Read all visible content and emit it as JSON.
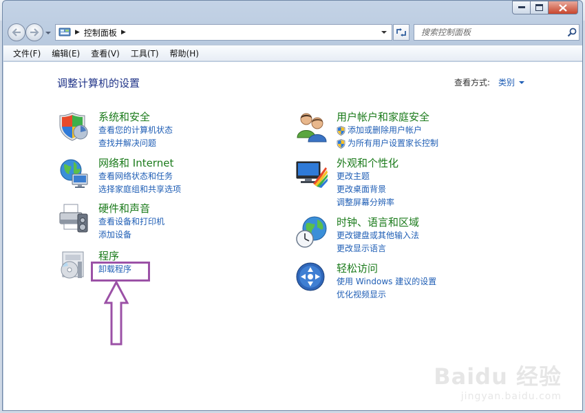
{
  "window": {
    "caption_buttons": [
      "minimize",
      "maximize",
      "close"
    ]
  },
  "nav": {
    "back_icon": "back-arrow-icon",
    "forward_icon": "forward-arrow-icon",
    "address_path": "控制面板",
    "search_placeholder": "搜索控制面板"
  },
  "menu": {
    "items": [
      "文件(F)",
      "编辑(E)",
      "查看(V)",
      "工具(T)",
      "帮助(H)"
    ]
  },
  "content": {
    "title": "调整计算机的设置",
    "view_by_label": "查看方式:",
    "view_by_value": "类别"
  },
  "categories": {
    "system": {
      "title": "系统和安全",
      "links": [
        "查看您的计算机状态",
        "查找并解决问题"
      ]
    },
    "network": {
      "title": "网络和 Internet",
      "links": [
        "查看网络状态和任务",
        "选择家庭组和共享选项"
      ]
    },
    "hardware": {
      "title": "硬件和声音",
      "links": [
        "查看设备和打印机",
        "添加设备"
      ]
    },
    "programs": {
      "title": "程序",
      "links": [
        "卸载程序"
      ]
    },
    "users": {
      "title": "用户帐户和家庭安全",
      "links": [
        "添加或删除用户帐户",
        "为所有用户设置家长控制"
      ]
    },
    "appearance": {
      "title": "外观和个性化",
      "links": [
        "更改主题",
        "更改桌面背景",
        "调整屏幕分辨率"
      ]
    },
    "clock": {
      "title": "时钟、语言和区域",
      "links": [
        "更改键盘或其他输入法",
        "更改显示语言"
      ]
    },
    "access": {
      "title": "轻松访问",
      "links": [
        "使用 Windows 建议的设置",
        "优化视频显示"
      ]
    }
  },
  "watermark": {
    "main": "Baidu 经验",
    "sub": "jingyan.baidu.com"
  },
  "colors": {
    "category_title": "#1a7a1a",
    "link": "#1f5eb5",
    "page_title": "#1e3287",
    "annotation": "#9b51a6"
  }
}
